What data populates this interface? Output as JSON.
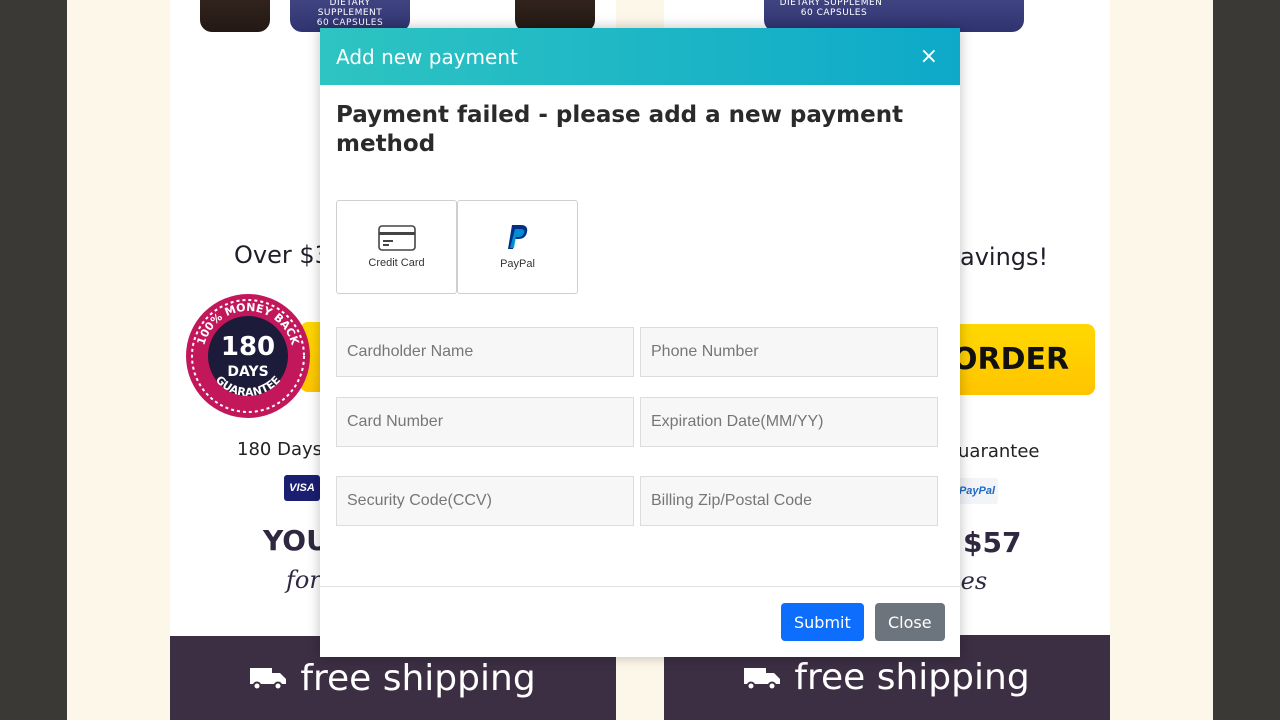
{
  "background": {
    "left_card": {
      "bottle_label": "DIETARY SUPPLEMENT",
      "bottle_sub": "60 CAPSULES",
      "savings_text": "Over $3",
      "guarantee_text": "180 Days",
      "price_text": "YOU",
      "per_text": "for",
      "shipping_text": "free shipping"
    },
    "right_card": {
      "bottle_label": "DIETARY SUPPLEMENT",
      "bottle_sub": "60 CAPSULES",
      "savings_text": "avings!",
      "order_button": "ORDER",
      "guarantee_text": "uarantee",
      "price_text": "$57",
      "per_text": "les",
      "shipping_text": "free shipping"
    },
    "badge": {
      "top_text": "100% MONEY BACK",
      "days": "180",
      "days_label": "DAYS",
      "bottom_text": "GUARANTEE"
    },
    "card_logos": {
      "visa": "VISA",
      "paypal": "PayPal"
    }
  },
  "modal": {
    "title": "Add new payment",
    "close_icon": "×",
    "heading": "Payment failed - please add a new payment method",
    "payment_methods": [
      {
        "label": "Credit Card",
        "icon": "credit-card-icon"
      },
      {
        "label": "PayPal",
        "icon": "paypal-icon"
      }
    ],
    "fields": {
      "cardholder_name": {
        "placeholder": "Cardholder Name",
        "value": ""
      },
      "phone_number": {
        "placeholder": "Phone Number",
        "value": ""
      },
      "card_number": {
        "placeholder": "Card Number",
        "value": ""
      },
      "expiration": {
        "placeholder": "Expiration Date(MM/YY)",
        "value": ""
      },
      "security_code": {
        "placeholder": "Security Code(CCV)",
        "value": ""
      },
      "billing_zip": {
        "placeholder": "Billing Zip/Postal Code",
        "value": ""
      }
    },
    "submit_label": "Submit",
    "close_label": "Close"
  },
  "colors": {
    "header_gradient_start": "#2ec4c2",
    "header_gradient_end": "#0ea9c9",
    "submit": "#0d6efd",
    "close": "#6c757d",
    "order_button": "#ffd000",
    "shipping_bar": "#3c2e43"
  }
}
